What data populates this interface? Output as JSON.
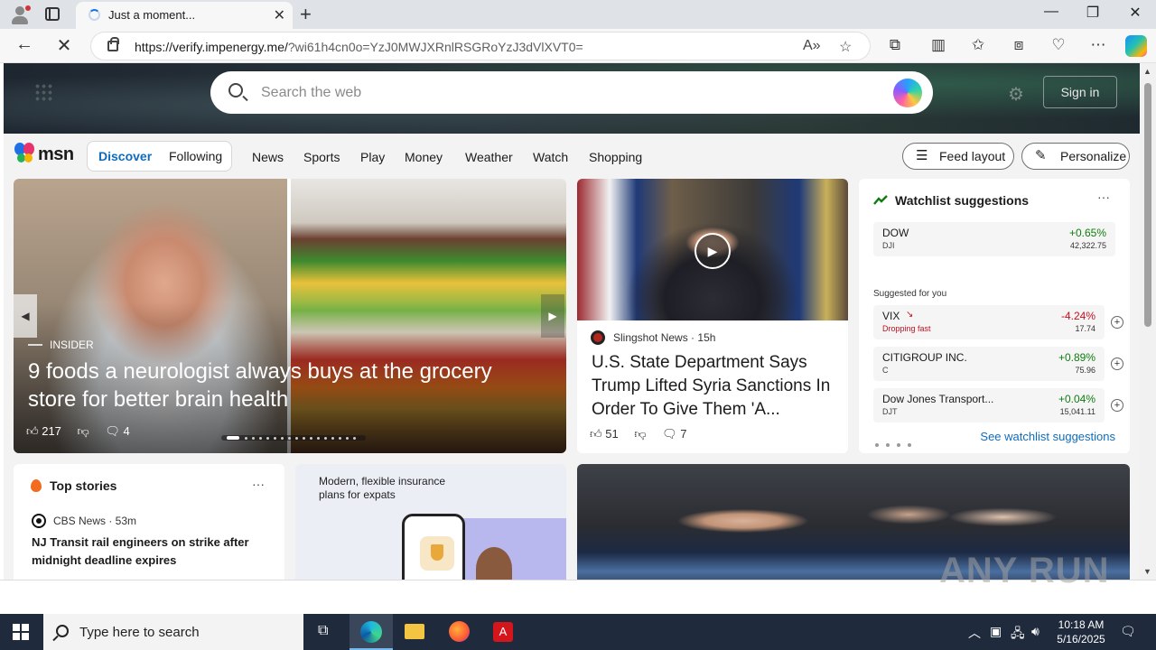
{
  "browser": {
    "tab_title": "Just a moment...",
    "url_host": "https://verify.impenergy.me/",
    "url_rest": "?wi61h4cn0o=YzJ0MWJXRnlRSGRoYzJ3dVlXVT0="
  },
  "header": {
    "search_placeholder": "Search the web",
    "sign_in": "Sign in"
  },
  "nav": {
    "logo_text": "msn",
    "segments": [
      "Discover",
      "Following"
    ],
    "links": [
      "News",
      "Sports",
      "Play",
      "Money",
      "Weather",
      "Watch",
      "Shopping"
    ],
    "feed_layout": "Feed layout",
    "personalize": "Personalize"
  },
  "hero": {
    "source": "INSIDER",
    "headline": "9 foods a neurologist always buys at the grocery store for better brain health",
    "likes": "217",
    "comments": "4"
  },
  "video_story": {
    "source": "Slingshot News",
    "age": "15h",
    "headline": "U.S. State Department Says Trump Lifted Syria Sanctions In Order To Give Them 'A...",
    "likes": "51",
    "comments": "7"
  },
  "watchlist": {
    "title": "Watchlist suggestions",
    "suggested_label": "Suggested for you",
    "see_all": "See watchlist suggestions",
    "featured": {
      "symbol": "DOW",
      "ticker": "DJI",
      "change": "+0.65%",
      "price": "42,322.75",
      "color": "#107c10"
    },
    "items": [
      {
        "symbol": "VIX",
        "sub": "Dropping fast",
        "change": "-4.24%",
        "price": "17.74",
        "color": "#c50f1f",
        "sub_color": "#c50f1f"
      },
      {
        "symbol": "CITIGROUP INC.",
        "sub": "C",
        "change": "+0.89%",
        "price": "75.96",
        "color": "#107c10",
        "sub_color": "#444444"
      },
      {
        "symbol": "Dow Jones Transport...",
        "sub": "DJT",
        "change": "+0.04%",
        "price": "15,041.11",
        "color": "#107c10",
        "sub_color": "#444444"
      }
    ]
  },
  "top_stories": {
    "title": "Top stories",
    "source": "CBS News · 53m",
    "headline": "NJ Transit rail engineers on strike after midnight deadline expires"
  },
  "ad": {
    "text": "Modern, flexible insurance plans for expats"
  },
  "watermark": "ANY RUN",
  "taskbar": {
    "search_placeholder": "Type here to search",
    "time": "10:18 AM",
    "date": "5/16/2025"
  },
  "colors": {
    "accent": "#0f6cbd",
    "taskbar": "#1f2b3d"
  }
}
